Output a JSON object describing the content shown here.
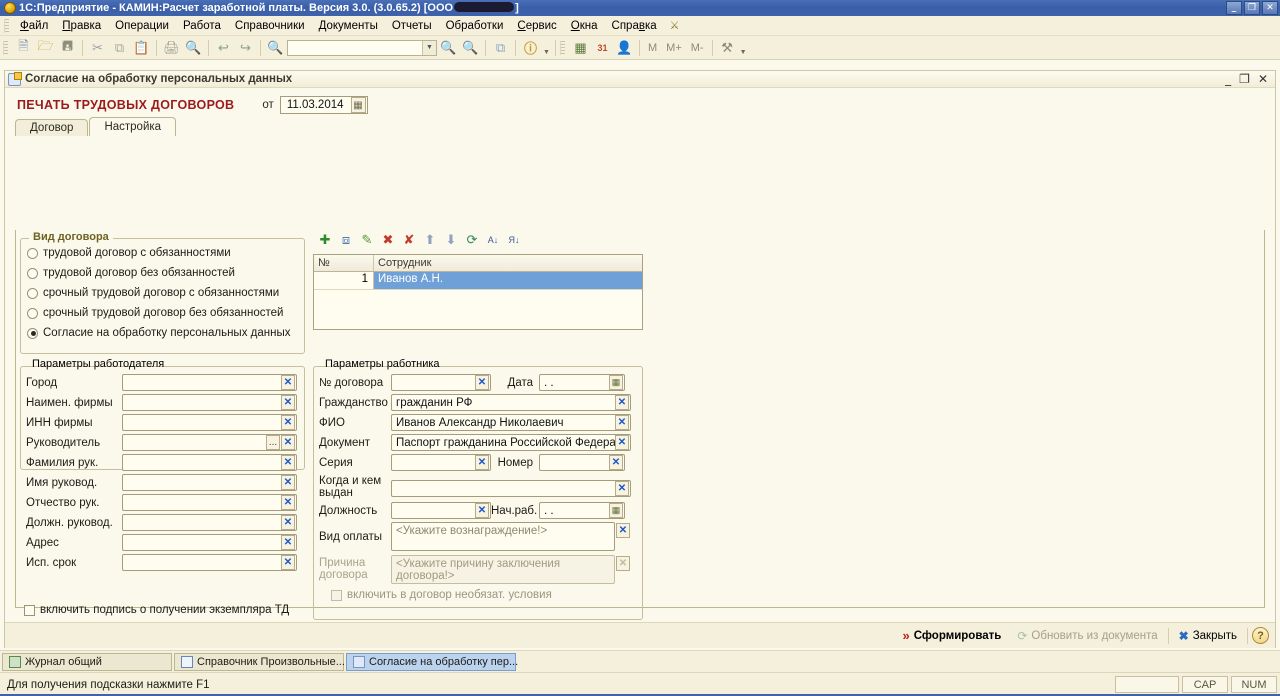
{
  "window": {
    "title_prefix": "1С:Предприятие - КАМИН:Расчет заработной платы.  Версия 3.0. (3.0.65.2) [ООО",
    "title_suffix": "]",
    "minimize": "_",
    "maximize": "❐",
    "close": "✕"
  },
  "menubar": {
    "items": [
      {
        "label": "Файл"
      },
      {
        "label": "Правка"
      },
      {
        "label": "Операции"
      },
      {
        "label": "Работа"
      },
      {
        "label": "Справочники"
      },
      {
        "label": "Документы"
      },
      {
        "label": "Отчеты"
      },
      {
        "label": "Обработки"
      },
      {
        "label": "Сервис"
      },
      {
        "label": "Окна"
      },
      {
        "label": "Справка"
      }
    ]
  },
  "toolbar": {
    "buttons": [
      {
        "name": "new-document",
        "glyph": "🗋"
      },
      {
        "name": "open-document",
        "glyph": "🗁"
      },
      {
        "name": "save-document",
        "glyph": "🖫"
      },
      {
        "name": "cut",
        "glyph": "✂"
      },
      {
        "name": "copy",
        "glyph": "⧉"
      },
      {
        "name": "paste",
        "glyph": "📋"
      },
      {
        "name": "print",
        "glyph": "🖨"
      },
      {
        "name": "print-preview",
        "glyph": "🔍"
      },
      {
        "name": "undo",
        "glyph": "↩"
      },
      {
        "name": "redo",
        "glyph": "↪"
      },
      {
        "name": "find",
        "glyph": "🔍"
      }
    ],
    "search_value": "",
    "search_placeholder": "",
    "after_buttons": [
      {
        "name": "find-next",
        "glyph": "🔍"
      },
      {
        "name": "find-prev",
        "glyph": "🔍"
      },
      {
        "name": "window-list",
        "glyph": "⧉"
      },
      {
        "name": "info",
        "glyph": "i"
      },
      {
        "name": "calculator",
        "glyph": "▦"
      },
      {
        "name": "calendar",
        "glyph": "31"
      },
      {
        "name": "user-settings",
        "glyph": "👤"
      }
    ],
    "memory": [
      "M",
      "M+",
      "M-"
    ],
    "tools_glyph": "⚒"
  },
  "mdi": {
    "title": "Согласие на обработку персональных данных",
    "minimize": "_",
    "restore": "❐",
    "close": "✕"
  },
  "form": {
    "title": "ПЕЧАТЬ ТРУДОВЫХ ДОГОВОРОВ",
    "date_label": "от",
    "date_value": "11.03.2014",
    "calendar_icon": "▦"
  },
  "tabs": [
    {
      "label": "Договор",
      "active": false
    },
    {
      "label": "Настройка",
      "active": true
    }
  ],
  "contract_kind": {
    "legend": "Вид договора",
    "options": [
      {
        "label": "трудовой договор с обязанностями",
        "selected": false
      },
      {
        "label": "трудовой договор без обязанностей",
        "selected": false
      },
      {
        "label": "срочный трудовой договор с обязанностями",
        "selected": false
      },
      {
        "label": "срочный трудовой договор без обязанностей",
        "selected": false
      },
      {
        "label": "Согласие на обработку персональных данных",
        "selected": true
      }
    ]
  },
  "employee_grid": {
    "tools": [
      {
        "name": "add-row-icon",
        "glyph": "✚"
      },
      {
        "name": "copy-row-icon",
        "glyph": "⎘"
      },
      {
        "name": "edit-row-icon",
        "glyph": "✎"
      },
      {
        "name": "delete-row-icon",
        "glyph": "✖"
      },
      {
        "name": "delete-all-icon",
        "glyph": "✖"
      },
      {
        "name": "move-up-icon",
        "glyph": "⬆"
      },
      {
        "name": "move-down-icon",
        "glyph": "⬇"
      },
      {
        "name": "refresh-icon",
        "glyph": "⟳"
      },
      {
        "name": "sort-asc-icon",
        "glyph": "А↓"
      },
      {
        "name": "sort-desc-icon",
        "glyph": "Я↓"
      }
    ],
    "columns": [
      "№",
      "Сотрудник"
    ],
    "rows": [
      {
        "num": "1",
        "employee": "Иванов А.Н.",
        "selected": true
      }
    ]
  },
  "employer_params": {
    "legend": "Параметры работодателя",
    "fields": [
      {
        "label": "Город",
        "value": "",
        "clear": "✕"
      },
      {
        "label": "Наимен. фирмы",
        "value": "",
        "clear": "✕"
      },
      {
        "label": "ИНН фирмы",
        "value": "",
        "clear": "✕"
      },
      {
        "label": "Руководитель",
        "value": "",
        "ellipsis": "...",
        "clear": "✕"
      },
      {
        "label": "Фамилия рук.",
        "value": "",
        "clear": "✕"
      },
      {
        "label": "Имя руковод.",
        "value": "",
        "clear": "✕"
      },
      {
        "label": "Отчество рук.",
        "value": "",
        "clear": "✕"
      },
      {
        "label": "Должн. руковод.",
        "value": "",
        "clear": "✕"
      },
      {
        "label": "Адрес",
        "value": "",
        "clear": "✕"
      },
      {
        "label": "Исп. срок",
        "value": "",
        "clear": "✕"
      }
    ],
    "checkbox": {
      "label": "включить подпись о получении экземпляра ТД",
      "checked": false
    }
  },
  "employee_params": {
    "legend": "Параметры работника",
    "contract_no_label": "№ договора",
    "contract_no_value": "",
    "date_label": "Дата",
    "date_value": ". .",
    "citizenship_label": "Гражданство",
    "citizenship_value": "гражданин РФ",
    "fio_label": "ФИО",
    "fio_value": "Иванов Александр Николаевич",
    "document_label": "Документ",
    "document_value": "Паспорт гражданина Российской Федера",
    "series_label": "Серия",
    "series_value": "",
    "number_label": "Номер",
    "number_value": "",
    "issued_label": "Когда и кем выдан",
    "issued_value": "",
    "position_label": "Должность",
    "position_value": "",
    "workstart_label": "Нач.раб.",
    "workstart_value": ". .",
    "payment_label": "Вид оплаты",
    "payment_value": "<Укажите вознаграждение!>",
    "reason_label": "Причина договора",
    "reason_value": "<Укажите причину заключения договора!>",
    "checkbox": {
      "label": "включить в договор необязат. условия",
      "checked": false
    },
    "clear_glyph": "✕",
    "calendar_glyph": "▦"
  },
  "commandbar": {
    "generate": "Сформировать",
    "generate_icon": "»",
    "refresh": "Обновить из документа",
    "refresh_icon": "⟳",
    "close": "Закрыть",
    "close_icon": "✖",
    "help": "?"
  },
  "taskbar": {
    "items": [
      {
        "label": "Журнал общий",
        "active": false,
        "icon": "journal-icon"
      },
      {
        "label": "Справочник Произвольные...",
        "active": false,
        "icon": "catalog-icon"
      },
      {
        "label": "Согласие на обработку пер...",
        "active": true,
        "icon": "document-icon"
      }
    ]
  },
  "statusbar": {
    "message": "Для получения подсказки нажмите F1",
    "panels": [
      "",
      "CAP",
      "NUM"
    ]
  }
}
